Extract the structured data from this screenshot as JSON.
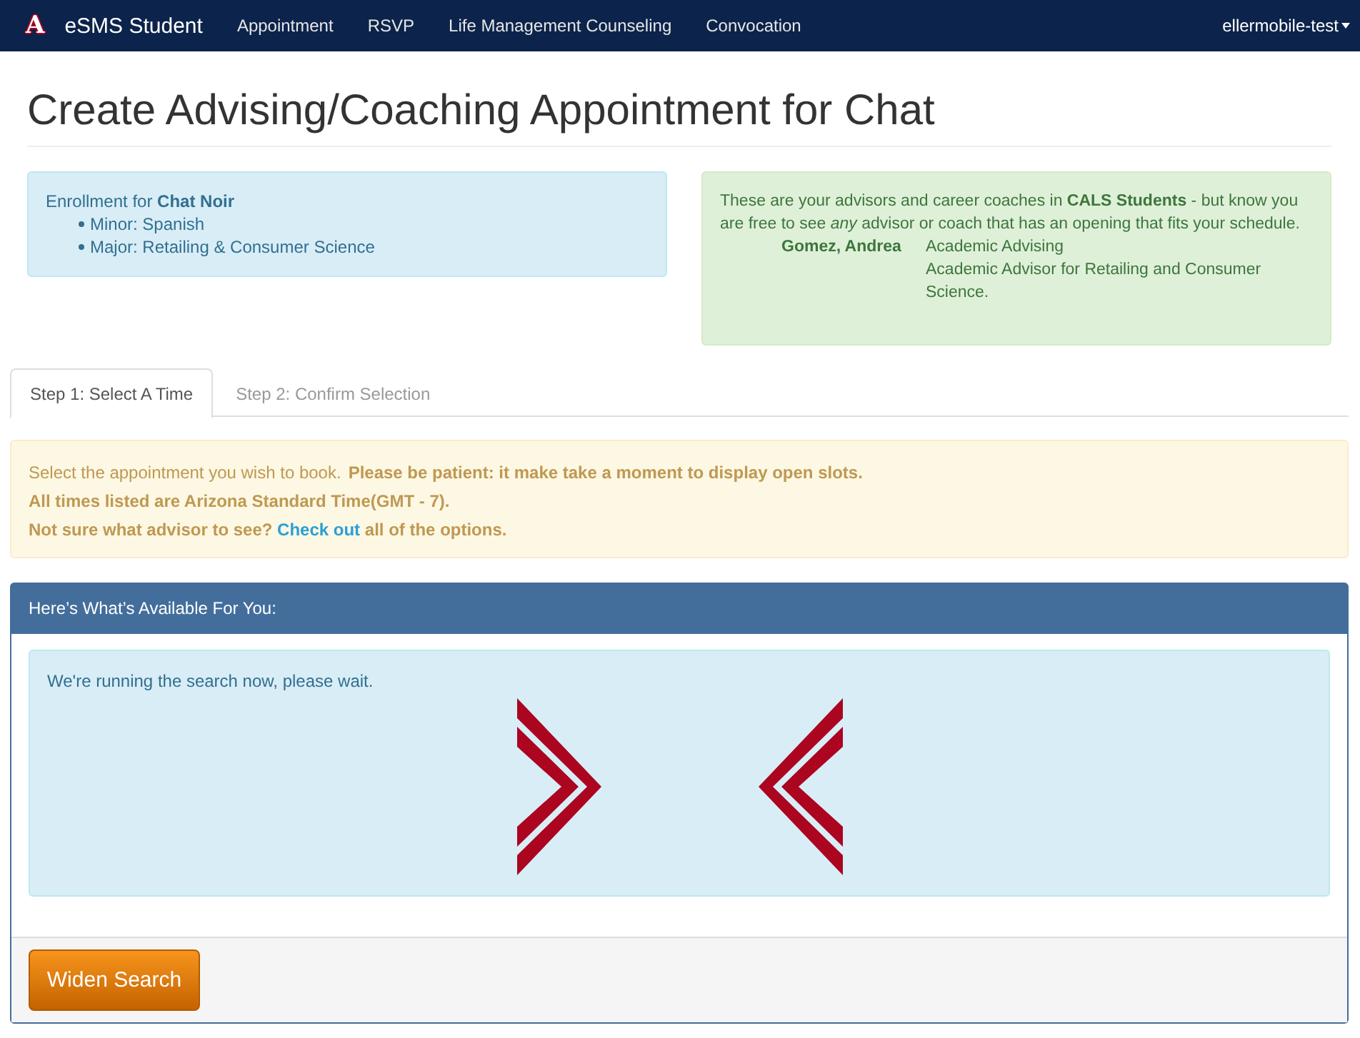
{
  "navbar": {
    "logo_mark": "A",
    "brand": "eSMS Student",
    "links": [
      "Appointment",
      "RSVP",
      "Life Management Counseling",
      "Convocation"
    ],
    "user_menu": "ellermobile-test"
  },
  "page_title": "Create Advising/Coaching Appointment for Chat",
  "enrollment": {
    "heading": "Enrollment for **Chat Noir**",
    "items": [
      "Minor: Spanish",
      "Major: Retailing & Consumer Science"
    ]
  },
  "advisors": {
    "intro": "These are your advisors and career coaches in **CALS Students** - but know you are free to see *any* advisor or coach that has an opening that fits your schedule.",
    "people": [
      {
        "name": "Gomez, Andrea",
        "role": "Academic Advising",
        "description": "Academic Advisor for Retailing and Consumer Science."
      }
    ]
  },
  "tabs": [
    {
      "label": "Step 1: Select A Time",
      "selected": true
    },
    {
      "label": "Step 2: Confirm Selection",
      "selected": false
    }
  ],
  "notice": {
    "instruction": "Select the appointment you wish to book.",
    "patience": "Please be patient: it make take a moment to display open slots.",
    "timezone": "All times listed are Arizona Standard Time(GMT - 7).",
    "help": {
      "before": "Not sure what advisor to see? ",
      "link": "Check out",
      "after": " all of the options."
    }
  },
  "results_panel": {
    "title": "Here’s What’s Available For You:",
    "status": "We're running the search now, please wait.",
    "button": "Widen Search"
  }
}
